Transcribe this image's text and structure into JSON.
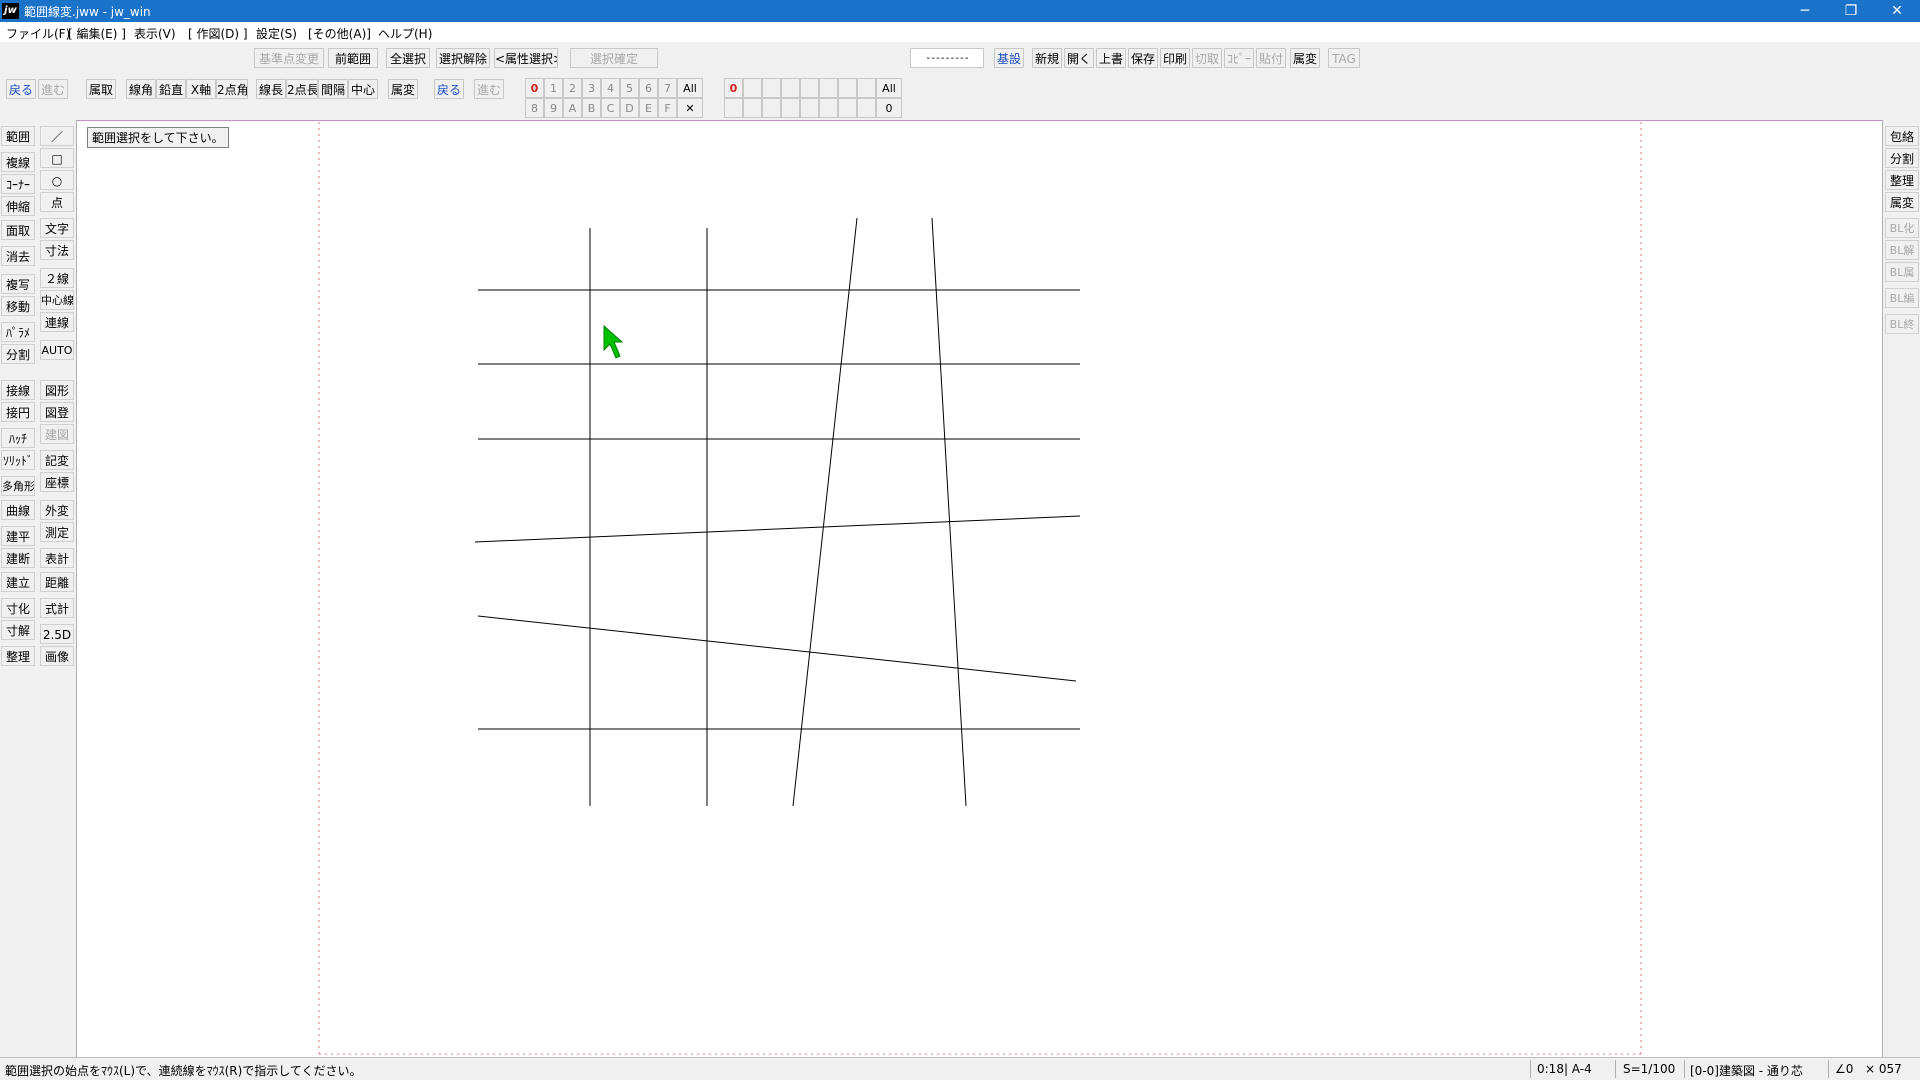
{
  "window": {
    "app_icon_text": "jw",
    "title": "範囲線変.jww - jw_win",
    "min_label": "─",
    "restore_label": "❐",
    "close_label": "✕"
  },
  "menu": {
    "file": "ファイル(F)",
    "edit": "[ 編集(E) ]",
    "view": "表示(V)",
    "draw": "[ 作図(D) ]",
    "settings": "設定(S)",
    "other": "[その他(A)]",
    "help": "ヘルプ(H)"
  },
  "toolbar1": {
    "base_change": "基準点変更",
    "prev_range": "前範囲",
    "select_all": "全選択",
    "deselect": "選択解除",
    "attr_select": "<属性選択>",
    "confirm": "選択確定",
    "linetype_sample": "- - - - - - - - -",
    "basic": "基設",
    "new": "新規",
    "open": "開く",
    "overwrite": "上書",
    "save": "保存",
    "print": "印刷",
    "cut": "切取",
    "copy": "ｺﾋﾟｰ",
    "paste": "貼付",
    "attr_change": "属変",
    "tag": "TAG"
  },
  "toolbar2": {
    "back": "戻る",
    "forward": "進む",
    "attr_get": "属取",
    "line_angle": "線角",
    "vertical": "鉛直",
    "x_axis": "X軸",
    "two_point_angle": "2点角",
    "line_length": "線長",
    "two_point_length": "2点長",
    "interval": "間隔",
    "center": "中心",
    "attr_change": "属変",
    "back2": "戻る",
    "forward2": "進む"
  },
  "layers": {
    "row1": [
      "0",
      "1",
      "2",
      "3",
      "4",
      "5",
      "6",
      "7",
      "All"
    ],
    "row2": [
      "8",
      "9",
      "A",
      "B",
      "C",
      "D",
      "E",
      "F",
      "✕"
    ]
  },
  "groups": {
    "active": "0",
    "all": "All",
    "current": "0"
  },
  "left_tools": {
    "col1": [
      "範囲",
      "複線",
      "ｺｰﾅｰ",
      "伸縮",
      "面取",
      "消去",
      "複写",
      "移動",
      "ﾊﾟﾗﾒ",
      "分割",
      "接線",
      "接円",
      "ﾊｯﾁ",
      "ｿﾘｯﾄﾞ",
      "多角形",
      "曲線",
      "建平",
      "建断",
      "建立",
      "寸化",
      "寸解",
      "整理"
    ],
    "col2": [
      "／",
      "□",
      "○",
      "点",
      "文字",
      "寸法",
      "２線",
      "中心線",
      "連線",
      "AUTO",
      "図形",
      "図登",
      "建図",
      "記変",
      "座標",
      "外変",
      "測定",
      "表計",
      "距離",
      "式計",
      "2.5D",
      "画像"
    ]
  },
  "right_tools": {
    "items": [
      "包絡",
      "分割",
      "整理",
      "属変",
      "BL化",
      "BL解",
      "BL属",
      "BL編",
      "BL終"
    ]
  },
  "canvas": {
    "tooltip": "範囲選択をして下さい。"
  },
  "status": {
    "message": "範囲選択の始点をﾏｳｽ(L)で、連続線をﾏｳｽ(R)で指示してください。",
    "layer_paper": "0:18| A-4",
    "scale": "S=1/100",
    "layer_name": "[0-0]建築図 - 通り芯",
    "angle": "∠0",
    "zoom": "× 057"
  },
  "colors": {
    "titlebar": "#1a73c9",
    "cursor": "#00c000",
    "paper_border": "#d07878"
  }
}
